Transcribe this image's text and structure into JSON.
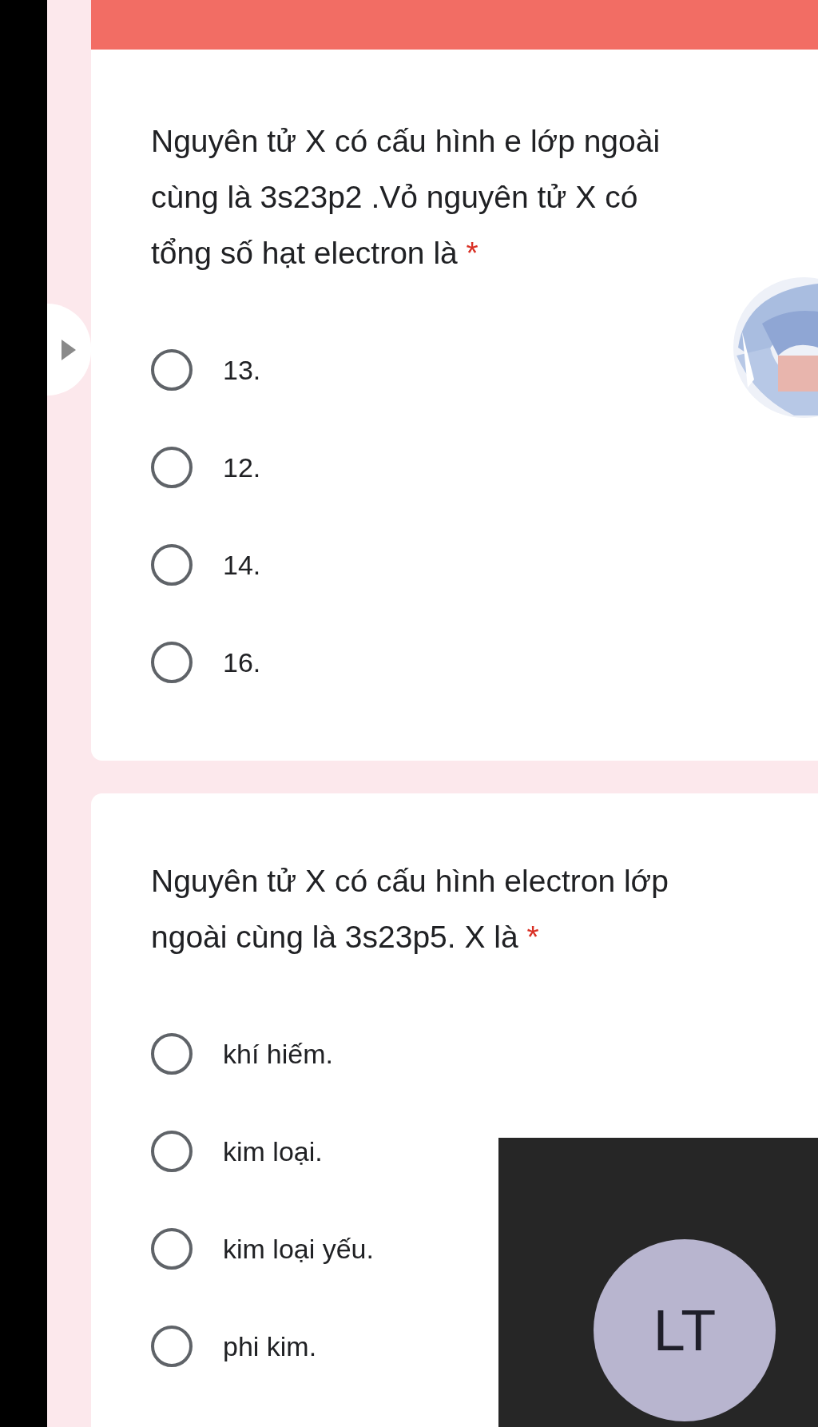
{
  "questions": [
    {
      "text": "Nguyên tử X có cấu hình e lớp ngoài cùng là 3s23p2 .Vỏ nguyên tử X có tổng số hạt electron là",
      "required_mark": "*",
      "options": [
        {
          "label": "13.",
          "selected": false
        },
        {
          "label": "12.",
          "selected": false
        },
        {
          "label": "14.",
          "selected": false
        },
        {
          "label": "16.",
          "selected": false
        }
      ]
    },
    {
      "text": "Nguyên tử X có cấu hình electron lớp ngoài cùng là 3s23p5. X là",
      "required_mark": "*",
      "options": [
        {
          "label": "khí hiếm.",
          "selected": false
        },
        {
          "label": "kim loại.",
          "selected": false
        },
        {
          "label": "kim loại yếu.",
          "selected": false
        },
        {
          "label": "phi kim.",
          "selected": false
        }
      ]
    }
  ],
  "video_overlay": {
    "initials": "LT"
  }
}
